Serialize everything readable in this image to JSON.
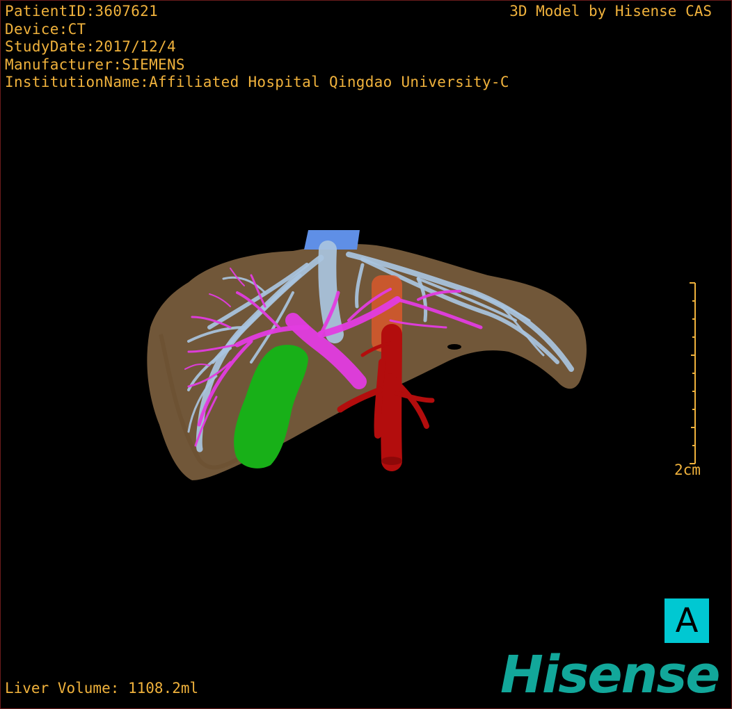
{
  "header": {
    "patient_id": "PatientID:3607621",
    "device": "Device:CT",
    "study_date": "StudyDate:2017/12/4",
    "manufacturer": "Manufacturer:SIEMENS",
    "institution": "InstitutionName:Affiliated Hospital Qingdao University-C",
    "credit": "3D Model by Hisense CAS"
  },
  "footer": {
    "liver_volume": "Liver Volume: 1108.2ml"
  },
  "scale": {
    "label": "2cm"
  },
  "orientation": {
    "label": "A"
  },
  "logo": {
    "text": "Hisense"
  },
  "colors": {
    "overlay_text": "#f0b23c",
    "liver": "#8a6a45",
    "hepatic_vein": "#a9c4e0",
    "portal_vein": "#e23ce0",
    "gallbladder": "#18b018",
    "artery": "#b30d0d",
    "ivc": "#5f8fe6",
    "orientation_bg": "#00c8d2",
    "logo": "#12a79a"
  }
}
